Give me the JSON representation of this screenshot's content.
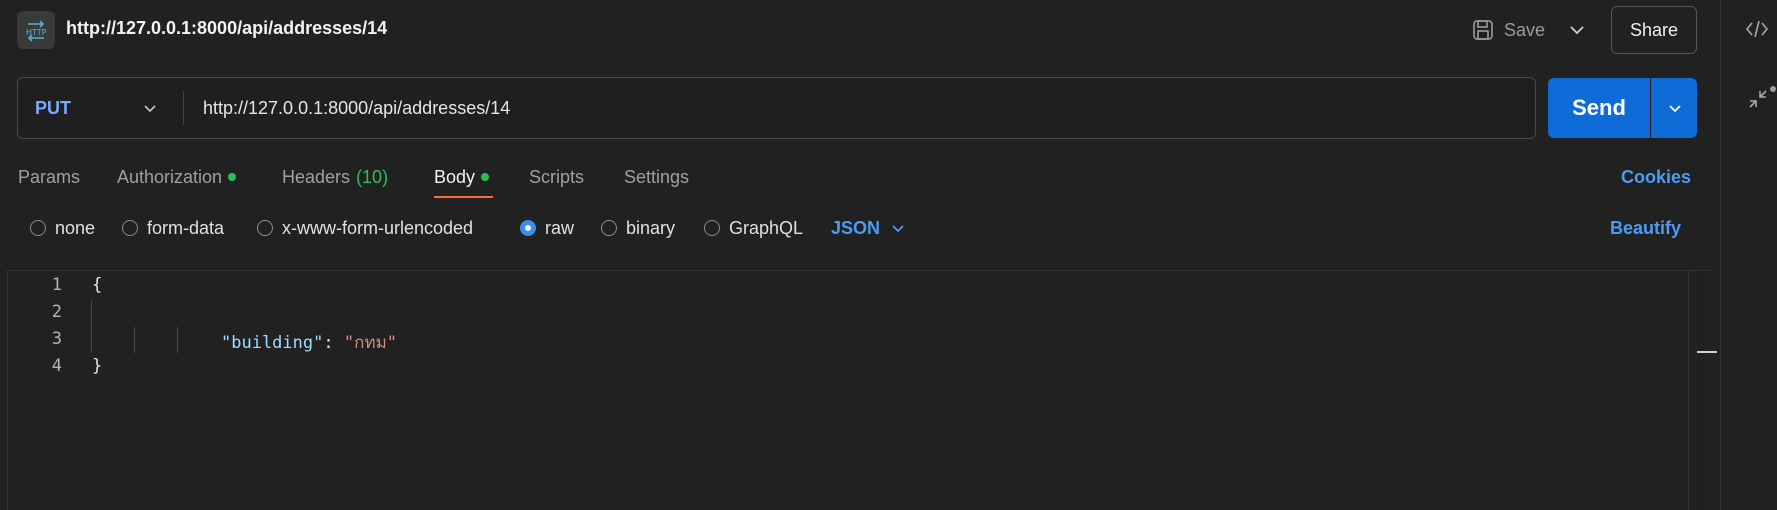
{
  "header": {
    "icon": "http-request-icon",
    "icon_text": "HTTP",
    "title": "http://127.0.0.1:8000/api/addresses/14",
    "save_label": "Save",
    "share_label": "Share"
  },
  "request": {
    "method": "PUT",
    "url": "http://127.0.0.1:8000/api/addresses/14",
    "send_label": "Send"
  },
  "tabs": [
    {
      "label": "Params"
    },
    {
      "label": "Authorization",
      "dot": true
    },
    {
      "label": "Headers",
      "count": "(10)"
    },
    {
      "label": "Body",
      "dot": true,
      "active": true
    },
    {
      "label": "Scripts"
    },
    {
      "label": "Settings"
    }
  ],
  "cookies_label": "Cookies",
  "body_types": [
    {
      "label": "none",
      "checked": false
    },
    {
      "label": "form-data",
      "checked": false
    },
    {
      "label": "x-www-form-urlencoded",
      "checked": false
    },
    {
      "label": "raw",
      "checked": true
    },
    {
      "label": "binary",
      "checked": false
    },
    {
      "label": "GraphQL",
      "checked": false
    }
  ],
  "language": "JSON",
  "beautify_label": "Beautify",
  "editor": {
    "line_numbers": [
      "1",
      "2",
      "3",
      "4"
    ],
    "open_brace": "{",
    "close_brace": "}",
    "key": "\"building\"",
    "colon": ": ",
    "value": "\"กทม\""
  },
  "colors": {
    "accent": "#0f6bd8",
    "link": "#4a9cf5",
    "method": "#7aa7ff",
    "status_dot": "#2ebd5a",
    "active_tab_underline": "#ff6c37"
  }
}
